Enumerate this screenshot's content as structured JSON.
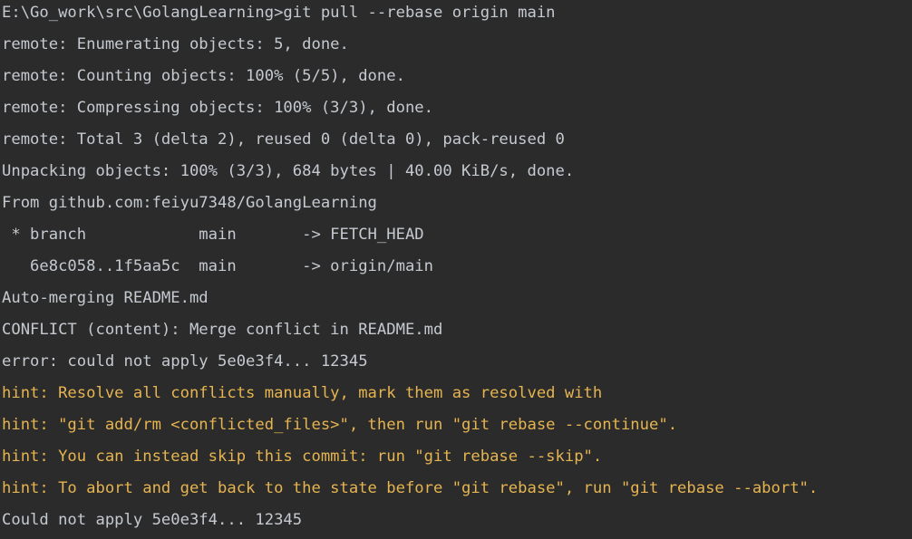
{
  "terminal": {
    "colors": {
      "background": "#2b2b2b",
      "text": "#c5cad0",
      "hint": "#e6b450"
    },
    "lines": [
      {
        "text": "E:\\Go_work\\src\\GolangLearning>git pull --rebase origin main",
        "kind": "command"
      },
      {
        "text": "remote: Enumerating objects: 5, done.",
        "kind": "output"
      },
      {
        "text": "remote: Counting objects: 100% (5/5), done.",
        "kind": "output"
      },
      {
        "text": "remote: Compressing objects: 100% (3/3), done.",
        "kind": "output"
      },
      {
        "text": "remote: Total 3 (delta 2), reused 0 (delta 0), pack-reused 0",
        "kind": "output"
      },
      {
        "text": "Unpacking objects: 100% (3/3), 684 bytes | 40.00 KiB/s, done.",
        "kind": "output"
      },
      {
        "text": "From github.com:feiyu7348/GolangLearning",
        "kind": "output"
      },
      {
        "text": " * branch            main       -> FETCH_HEAD",
        "kind": "output"
      },
      {
        "text": "   6e8c058..1f5aa5c  main       -> origin/main",
        "kind": "output"
      },
      {
        "text": "Auto-merging README.md",
        "kind": "output"
      },
      {
        "text": "CONFLICT (content): Merge conflict in README.md",
        "kind": "output"
      },
      {
        "text": "error: could not apply 5e0e3f4... 12345",
        "kind": "output"
      },
      {
        "text": "hint: Resolve all conflicts manually, mark them as resolved with",
        "kind": "hint"
      },
      {
        "text": "hint: \"git add/rm <conflicted_files>\", then run \"git rebase --continue\".",
        "kind": "hint"
      },
      {
        "text": "hint: You can instead skip this commit: run \"git rebase --skip\".",
        "kind": "hint"
      },
      {
        "text": "hint: To abort and get back to the state before \"git rebase\", run \"git rebase --abort\".",
        "kind": "hint"
      },
      {
        "text": "Could not apply 5e0e3f4... 12345",
        "kind": "output"
      }
    ]
  }
}
